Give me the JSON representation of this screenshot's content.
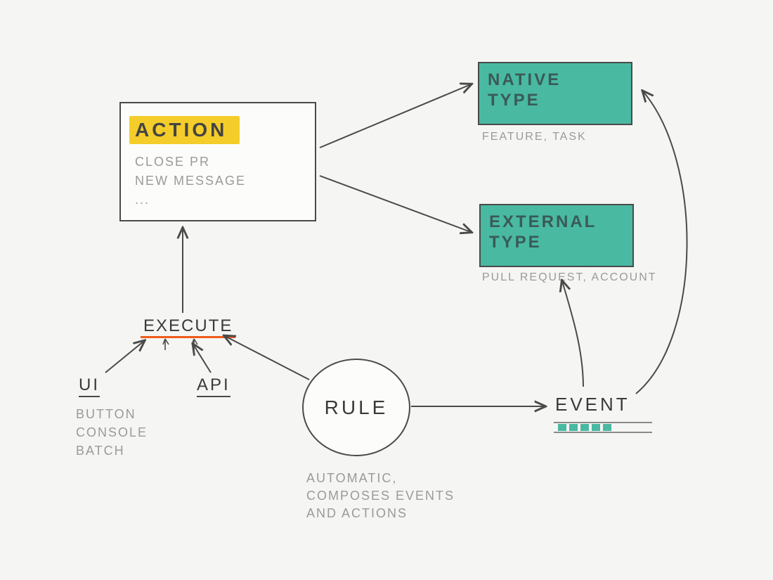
{
  "action": {
    "title": "ACTION",
    "examples": [
      "CLOSE PR",
      "NEW MESSAGE",
      "..."
    ]
  },
  "native_type": {
    "title_line1": "NATIVE",
    "title_line2": "TYPE",
    "examples": "FEATURE, TASK"
  },
  "external_type": {
    "title_line1": "EXTERNAL",
    "title_line2": "TYPE",
    "examples": "PULL REQUEST, ACCOUNT"
  },
  "rule": {
    "title": "RULE",
    "desc_line1": "AUTOMATIC,",
    "desc_line2": "COMPOSES EVENTS",
    "desc_line3": "AND ACTIONS"
  },
  "execute": {
    "label": "EXECUTE"
  },
  "ui": {
    "label": "UI",
    "desc_line1": "BUTTON",
    "desc_line2": "CONSOLE",
    "desc_line3": "BATCH"
  },
  "api": {
    "label": "API"
  },
  "event": {
    "label": "EVENT"
  },
  "colors": {
    "highlight": "#f4cd2a",
    "teal": "#49b9a2",
    "underline": "#f05a1c",
    "ink": "#4a4a4a",
    "muted": "#9a9a96",
    "bg": "#f5f5f3"
  }
}
